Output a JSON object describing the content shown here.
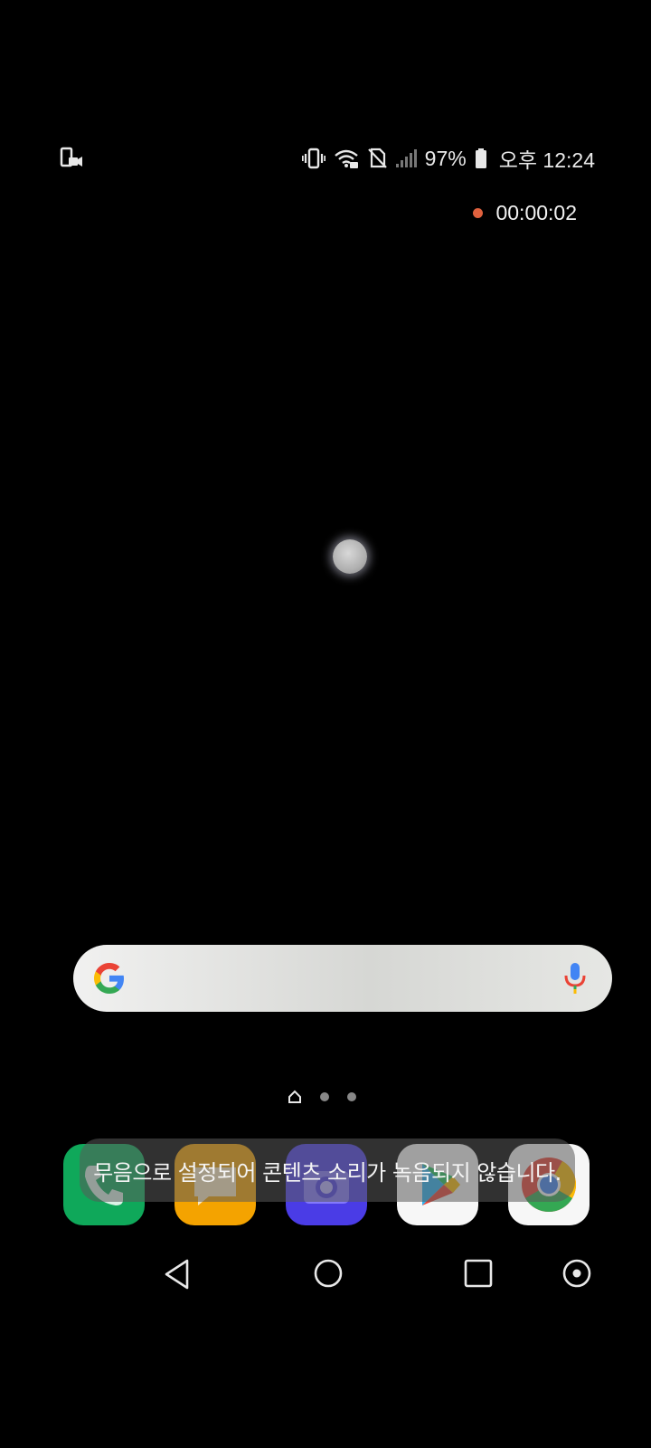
{
  "status_bar": {
    "left_icon": "screen-record-icon",
    "icons": [
      "vibrate-icon",
      "wifi-icon",
      "no-sim-icon",
      "signal-icon"
    ],
    "battery_percent": "97%",
    "battery_icon": "battery-icon",
    "clock": "오후 12:24"
  },
  "recording": {
    "elapsed": "00:00:02",
    "indicator_color": "#e0613e"
  },
  "search": {
    "logo_icon": "google-g-icon",
    "mic_icon": "microphone-icon"
  },
  "page_indicator": {
    "home_icon": "home-icon",
    "pages": 3,
    "current": 0
  },
  "dock": {
    "apps": [
      {
        "name": "phone",
        "icon": "phone-icon",
        "color": "#0f9d58"
      },
      {
        "name": "messages",
        "icon": "message-icon",
        "color": "#f5a800"
      },
      {
        "name": "camera",
        "icon": "camera-icon",
        "color": "#4a3de6"
      },
      {
        "name": "play-store",
        "icon": "play-store-icon",
        "color": "#ffffff"
      },
      {
        "name": "chrome",
        "icon": "chrome-icon",
        "color": "#ffffff"
      }
    ]
  },
  "toast": {
    "message": "무음으로 설정되어 콘텐츠 소리가 녹음되지 않습니다."
  },
  "nav_bar": {
    "back_icon": "back-icon",
    "home_icon": "home-circle-icon",
    "recents_icon": "recents-icon",
    "extra_icon": "dot-circle-icon"
  }
}
